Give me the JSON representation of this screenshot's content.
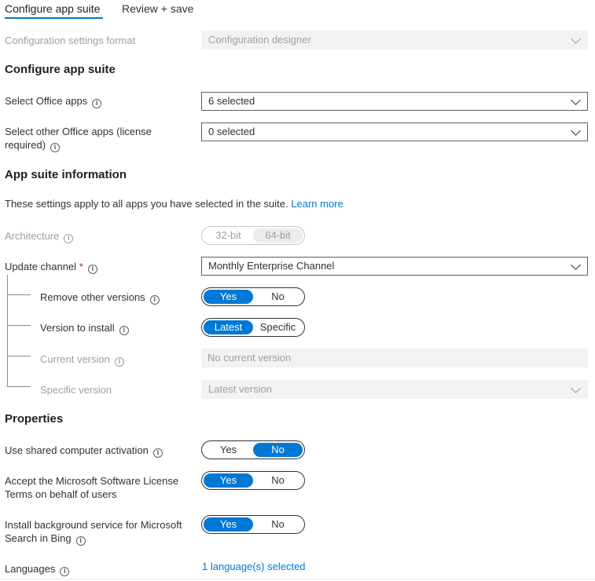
{
  "tabs": [
    {
      "label": "Configure app suite",
      "active": true
    },
    {
      "label": "Review + save",
      "active": false
    }
  ],
  "config_format": {
    "label": "Configuration settings format",
    "value": "Configuration designer"
  },
  "section_configure": {
    "title": "Configure app suite"
  },
  "select_office_apps": {
    "label": "Select Office apps",
    "value": "6 selected"
  },
  "select_other_apps": {
    "label_line1": "Select other Office apps (license",
    "label_line2": "required)",
    "value": "0 selected"
  },
  "section_info": {
    "title": "App suite information",
    "description": "These settings apply to all apps you have selected in the suite.",
    "learn_more": "Learn more"
  },
  "architecture": {
    "label": "Architecture",
    "options": [
      "32-bit",
      "64-bit"
    ],
    "selected": "64-bit"
  },
  "update_channel": {
    "label": "Update channel",
    "required_mark": "*",
    "value": "Monthly Enterprise Channel"
  },
  "remove_other_versions": {
    "label": "Remove other versions",
    "options": [
      "Yes",
      "No"
    ],
    "selected": "Yes"
  },
  "version_to_install": {
    "label": "Version to install",
    "options": [
      "Latest",
      "Specific"
    ],
    "selected": "Latest"
  },
  "current_version": {
    "label": "Current version",
    "value": "No current version"
  },
  "specific_version": {
    "label": "Specific version",
    "value": "Latest version"
  },
  "section_properties": {
    "title": "Properties"
  },
  "shared_activation": {
    "label": "Use shared computer activation",
    "options": [
      "Yes",
      "No"
    ],
    "selected": "No"
  },
  "accept_license": {
    "label_line1": "Accept the Microsoft Software License",
    "label_line2": "Terms on behalf of users",
    "options": [
      "Yes",
      "No"
    ],
    "selected": "Yes"
  },
  "background_service": {
    "label_line1": "Install background service for Microsoft",
    "label_line2": "Search in Bing",
    "options": [
      "Yes",
      "No"
    ],
    "selected": "Yes"
  },
  "languages": {
    "label": "Languages",
    "value": "1 language(s) selected"
  },
  "icons": {
    "info": "i"
  },
  "colors": {
    "accent": "#0078d4",
    "required": "#a4262c",
    "disabled_bg": "#f3f2f1",
    "disabled_text": "#a19f9d"
  }
}
